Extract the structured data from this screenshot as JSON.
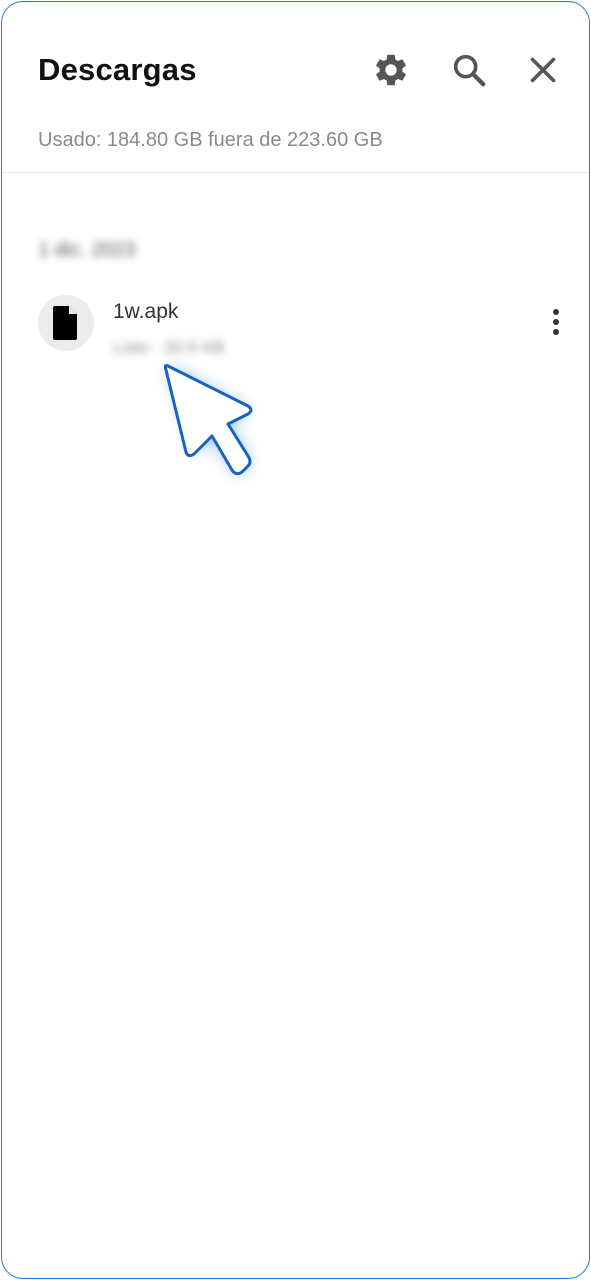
{
  "header": {
    "title": "Descargas",
    "storage_text": "Usado: 184.80 GB fuera de 223.60 GB",
    "icons": [
      "gear-icon",
      "search-icon",
      "close-icon"
    ]
  },
  "downloads": {
    "groups": [
      {
        "date": "1 dic. 2023",
        "items": [
          {
            "name": "1w.apk",
            "meta": "Listo · 33.5 KB",
            "icon": "file-icon"
          }
        ]
      }
    ]
  },
  "colors": {
    "frame_border": "#1a7be0",
    "cursor_glow": "#1a7be0",
    "icon_gray": "#555555"
  }
}
